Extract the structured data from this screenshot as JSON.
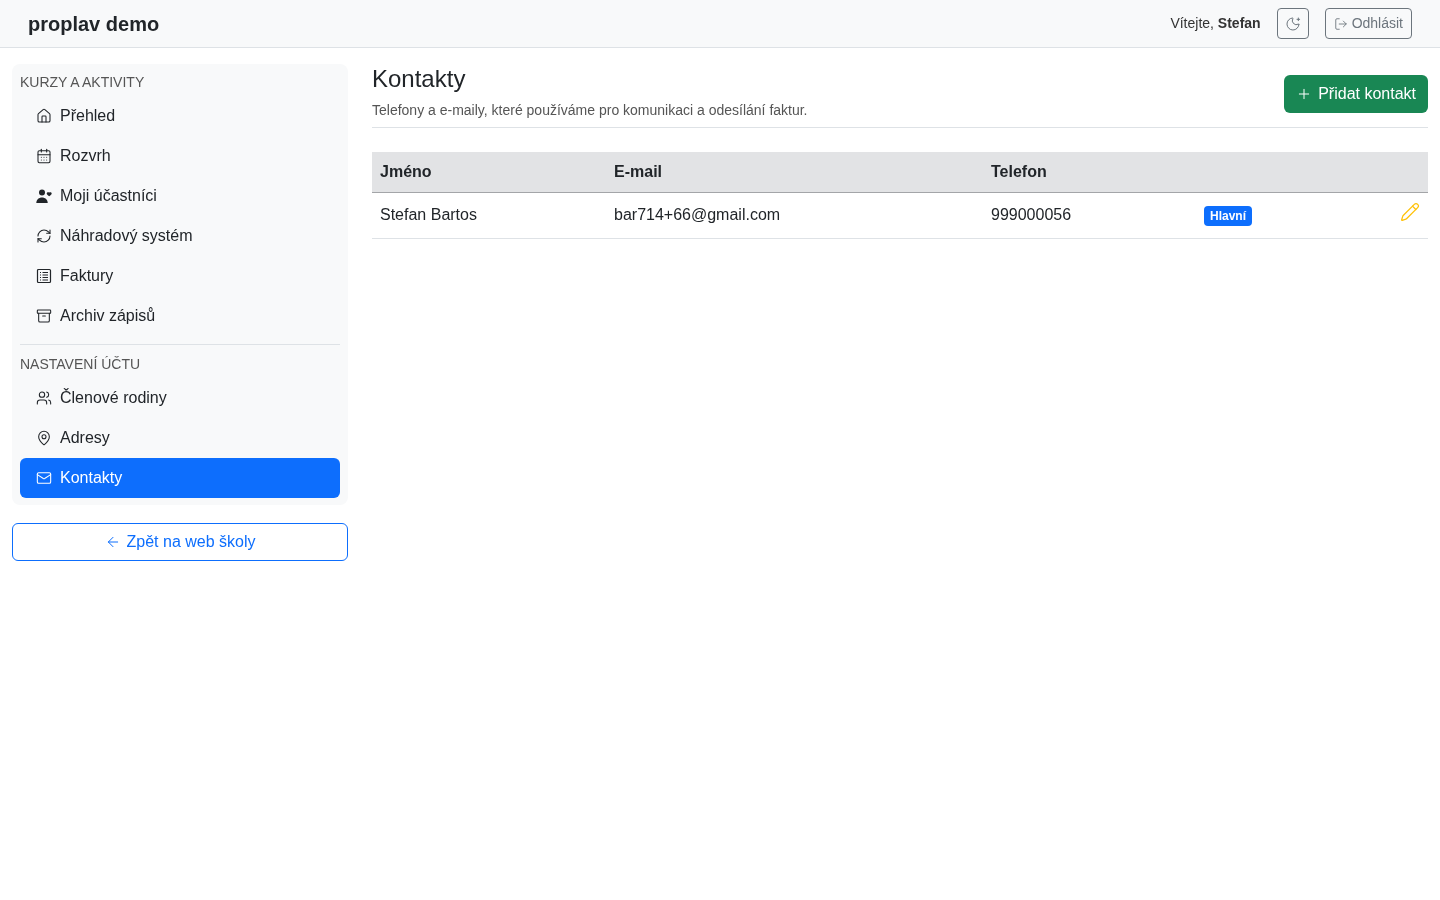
{
  "header": {
    "brand": "proplav demo",
    "greeting": "Vítejte, **Stefan**",
    "logout_button": "Odhlásit"
  },
  "sidebar": {
    "sections": [
      {
        "heading": "KURZY A AKTIVITY",
        "items": [
          {
            "label": "Přehled",
            "selected": false
          },
          {
            "label": "Rozvrh",
            "selected": false
          },
          {
            "label": "Moji účastníci",
            "selected": false
          },
          {
            "label": "Náhradový systém",
            "selected": false
          },
          {
            "label": "Faktury",
            "selected": false
          },
          {
            "label": "Archiv zápisů",
            "selected": false
          }
        ]
      },
      {
        "heading": "NASTAVENÍ ÚČTU",
        "items": [
          {
            "label": "Členové rodiny",
            "selected": false
          },
          {
            "label": "Adresy",
            "selected": false
          },
          {
            "label": "Kontakty",
            "selected": true
          }
        ]
      }
    ],
    "back_button": "Zpět na web školy"
  },
  "main": {
    "title": "Kontakty",
    "description": "Telefony a e-maily, které používáme pro komunikaci a odesílání faktur.",
    "add_button": "Přidat kontakt",
    "table": {
      "columns": [
        "Jméno",
        "E-mail",
        "Telefon"
      ],
      "rows": [
        {
          "name": "Stefan Bartos",
          "email": "bar714+66@gmail.com",
          "phone": "999000056",
          "badge": "Hlavní"
        }
      ]
    }
  }
}
